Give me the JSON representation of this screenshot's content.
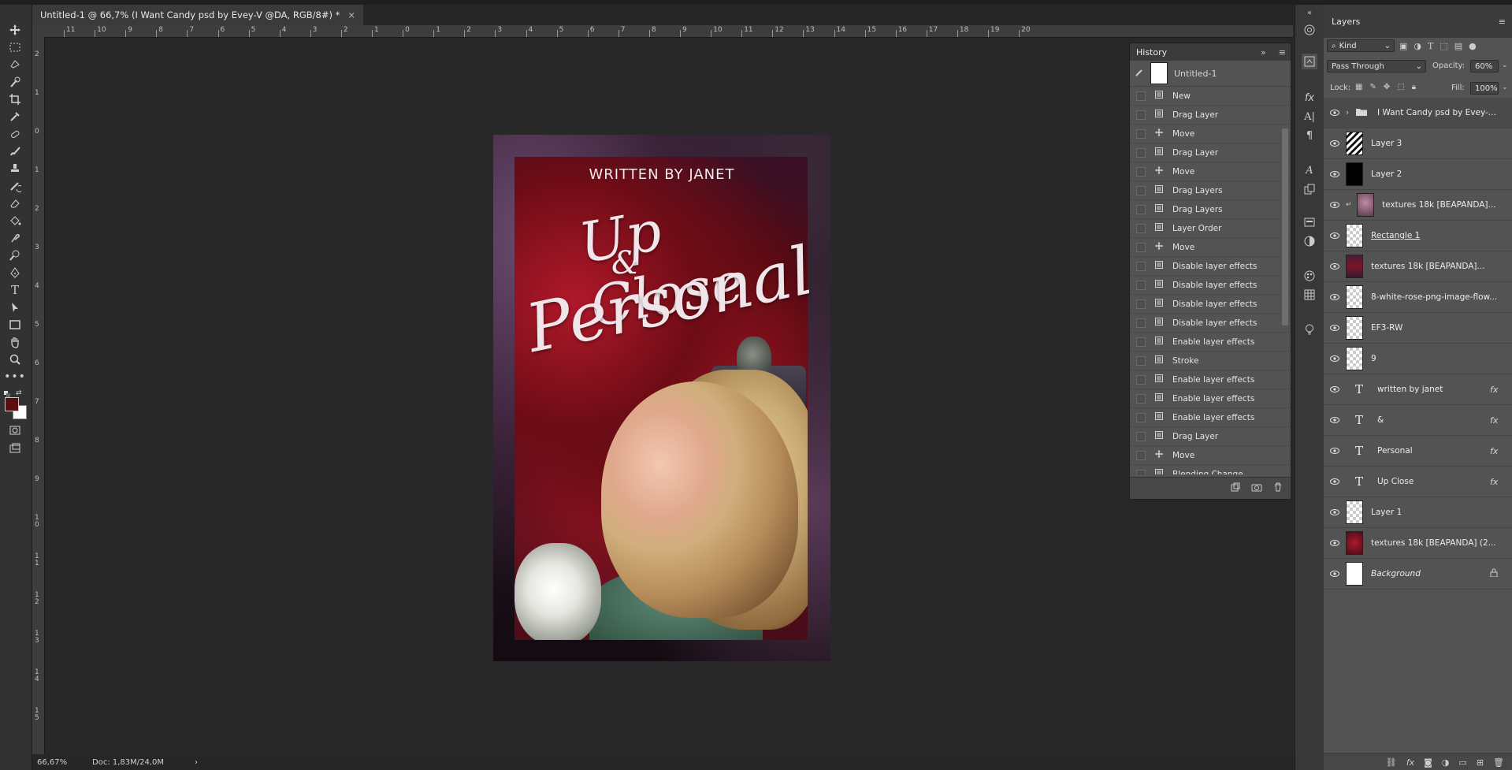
{
  "document": {
    "tab_title": "Untitled-1 @ 66,7% (I Want Candy psd by Evey-V @DA, RGB/8#) *",
    "close_symbol": "×"
  },
  "ruler": {
    "h_labels": [
      "11",
      "10",
      "9",
      "8",
      "7",
      "6",
      "5",
      "4",
      "3",
      "2",
      "1",
      "0",
      "1",
      "2",
      "3",
      "4",
      "5",
      "6",
      "7",
      "8",
      "9",
      "10",
      "11",
      "12",
      "13",
      "14",
      "15",
      "16",
      "17",
      "18",
      "19",
      "20"
    ],
    "v_labels": [
      "2",
      "1",
      "0",
      "1",
      "2",
      "3",
      "4",
      "5",
      "6",
      "7",
      "8",
      "9",
      "1\n0",
      "1\n1",
      "1\n2",
      "1\n3",
      "1\n4",
      "1\n5"
    ]
  },
  "status": {
    "zoom": "66,67%",
    "doc": "Doc: 1,83M/24,0M",
    "arrow": "›"
  },
  "poster": {
    "written_by": "WRITTEN BY JANET",
    "up_close": "Up Close",
    "amp": "&",
    "personal": "Personal"
  },
  "history": {
    "tab": "History",
    "snapshot": "Untitled-1",
    "expand": "»",
    "items": [
      {
        "label": "New",
        "icon": "document-icon"
      },
      {
        "label": "Drag Layer",
        "icon": "document-icon"
      },
      {
        "label": "Move",
        "icon": "move-icon"
      },
      {
        "label": "Drag Layer",
        "icon": "document-icon"
      },
      {
        "label": "Move",
        "icon": "move-icon"
      },
      {
        "label": "Drag Layers",
        "icon": "document-icon"
      },
      {
        "label": "Drag Layers",
        "icon": "document-icon"
      },
      {
        "label": "Layer Order",
        "icon": "document-icon"
      },
      {
        "label": "Move",
        "icon": "move-icon"
      },
      {
        "label": "Disable layer effects",
        "icon": "document-icon"
      },
      {
        "label": "Disable layer effects",
        "icon": "document-icon"
      },
      {
        "label": "Disable layer effects",
        "icon": "document-icon"
      },
      {
        "label": "Disable layer effects",
        "icon": "document-icon"
      },
      {
        "label": "Enable layer effects",
        "icon": "document-icon"
      },
      {
        "label": "Stroke",
        "icon": "document-icon"
      },
      {
        "label": "Enable layer effects",
        "icon": "document-icon"
      },
      {
        "label": "Enable layer effects",
        "icon": "document-icon"
      },
      {
        "label": "Enable layer effects",
        "icon": "document-icon"
      },
      {
        "label": "Drag Layer",
        "icon": "document-icon"
      },
      {
        "label": "Move",
        "icon": "move-icon"
      },
      {
        "label": "Blending Change",
        "icon": "document-icon"
      }
    ]
  },
  "layers": {
    "tab": "Layers",
    "filter_kind": "Kind",
    "blend_mode": "Pass Through",
    "opacity_label": "Opacity:",
    "opacity_value": "60%",
    "lock_label": "Lock:",
    "fill_label": "Fill:",
    "fill_value": "100%",
    "fx_label": "fx",
    "items": [
      {
        "name": "I Want Candy psd by Evey-...",
        "kind": "group"
      },
      {
        "name": "Layer 3",
        "kind": "pattern"
      },
      {
        "name": "Layer 2",
        "kind": "black"
      },
      {
        "name": "textures 18k [BEAPANDA]...",
        "kind": "photo-clip"
      },
      {
        "name": "Rectangle 1",
        "kind": "checker"
      },
      {
        "name": "textures 18k [BEAPANDA]...",
        "kind": "purple"
      },
      {
        "name": "8-white-rose-png-image-flow...",
        "kind": "checker"
      },
      {
        "name": "EF3-RW",
        "kind": "checker"
      },
      {
        "name": "9",
        "kind": "checker"
      },
      {
        "name": "written by janet",
        "kind": "text"
      },
      {
        "name": "&",
        "kind": "text"
      },
      {
        "name": "Personal",
        "kind": "text"
      },
      {
        "name": "Up Close",
        "kind": "text"
      },
      {
        "name": "Layer 1",
        "kind": "checker"
      },
      {
        "name": "textures 18k [BEAPANDA] (2...",
        "kind": "red"
      },
      {
        "name": "Background",
        "kind": "white"
      }
    ]
  },
  "colors": {
    "foreground": "#5a0f0f",
    "background": "#ffffff"
  }
}
